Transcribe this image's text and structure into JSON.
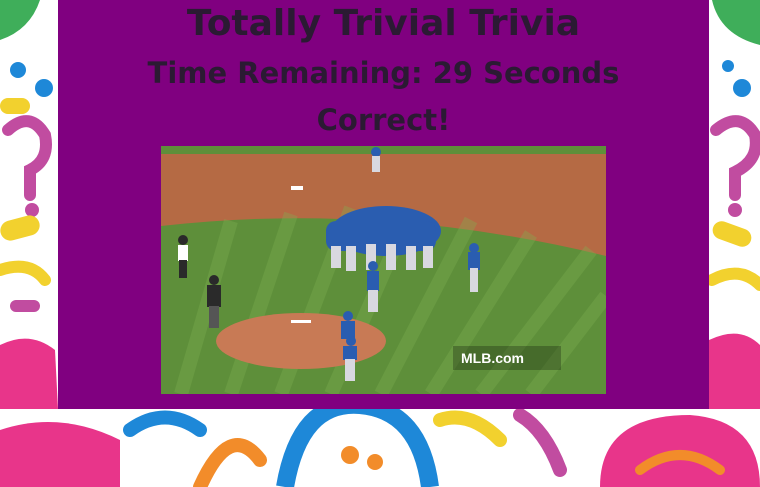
{
  "page": {
    "title": "Totally Trivial Trivia",
    "timer_text": "Time Remaining: 29 Seconds",
    "result_text": "Correct!"
  },
  "image": {
    "description_icon": "baseball-celebration-image",
    "watermark_text": "MLB.com"
  },
  "colors": {
    "panel": "#800080",
    "heading_text": "#2b1a33",
    "grass": "#5e8f3a",
    "infield_dirt": "#b56a44",
    "jersey_blue": "#2a5db0"
  }
}
